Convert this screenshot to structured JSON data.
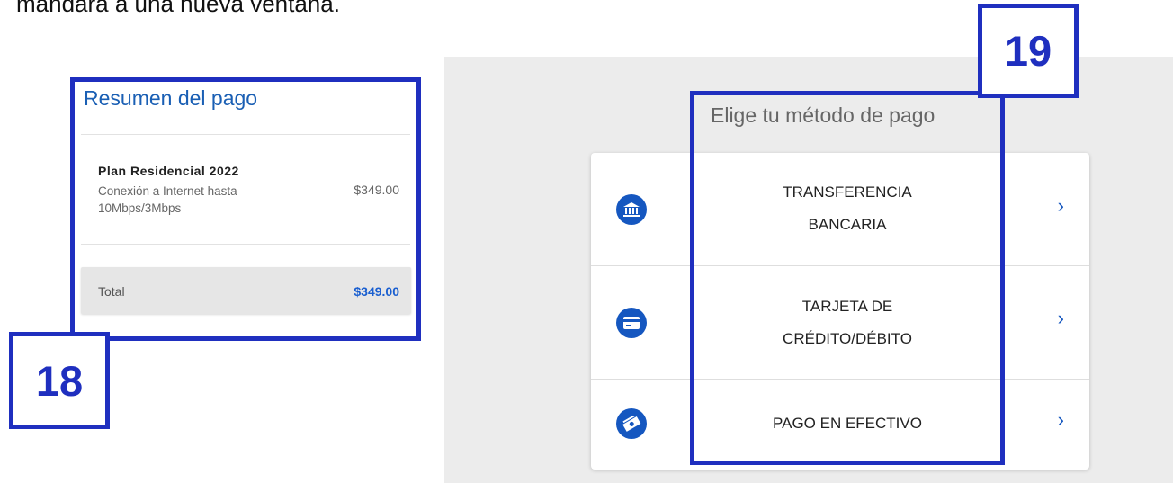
{
  "caption": "mandará a una nueva ventana.",
  "summary": {
    "title": "Resumen del pago",
    "plan_name": "Plan Residencial 2022",
    "plan_desc": "Conexión a Internet hasta 10Mbps/3Mbps",
    "plan_price": "$349.00",
    "total_label": "Total",
    "total_value": "$349.00"
  },
  "annotations": {
    "left": "18",
    "right": "19"
  },
  "payment": {
    "title": "Elige tu método de pago",
    "methods": [
      {
        "line1": "TRANSFERENCIA",
        "line2": "BANCARIA",
        "icon": "bank-icon"
      },
      {
        "line1": "TARJETA DE",
        "line2": "CRÉDITO/DÉBITO",
        "icon": "credit-card-icon"
      },
      {
        "line1": "PAGO EN EFECTIVO",
        "line2": "",
        "icon": "cash-icon"
      }
    ],
    "chevron": "›"
  },
  "colors": {
    "accent": "#1557c0",
    "annotation": "#1f2fbf",
    "total_value": "#1a5fd0"
  }
}
